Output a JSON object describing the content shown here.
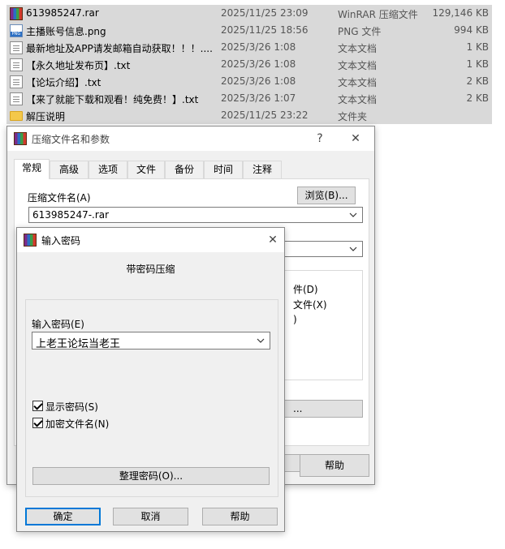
{
  "files": [
    {
      "icon": "rar-archive-icon",
      "name": "613985247.rar",
      "date": "2025/11/25 23:09",
      "type": "WinRAR 压缩文件",
      "size": "129,146 KB"
    },
    {
      "icon": "png-file-icon",
      "name": "主播账号信息.png",
      "date": "2025/11/25 18:56",
      "type": "PNG 文件",
      "size": "994 KB"
    },
    {
      "icon": "text-file-icon",
      "name": "最新地址及APP请发邮箱自动获取！！！....",
      "date": "2025/3/26 1:08",
      "type": "文本文档",
      "size": "1 KB"
    },
    {
      "icon": "text-file-icon",
      "name": "【永久地址发布页】.txt",
      "date": "2025/3/26 1:08",
      "type": "文本文档",
      "size": "1 KB"
    },
    {
      "icon": "text-file-icon",
      "name": "【论坛介绍】.txt",
      "date": "2025/3/26 1:08",
      "type": "文本文档",
      "size": "2 KB"
    },
    {
      "icon": "text-file-icon",
      "name": "【来了就能下载和观看！纯免费！】.txt",
      "date": "2025/3/26 1:07",
      "type": "文本文档",
      "size": "2 KB"
    },
    {
      "icon": "folder-icon",
      "name": "解压说明",
      "date": "2025/11/25 23:22",
      "type": "文件夹",
      "size": ""
    }
  ],
  "archive_dialog": {
    "title": "压缩文件名和参数",
    "help_glyph": "?",
    "close_glyph": "✕",
    "tabs": [
      "常规",
      "高级",
      "选项",
      "文件",
      "备份",
      "时间",
      "注释"
    ],
    "archive_name_label": "压缩文件名(A)",
    "browse_label": "浏览(B)...",
    "archive_name_value": "613985247-.rar",
    "hidden_option_1": "件(D)",
    "hidden_option_2": "文件(X)",
    "hidden_option_3": ")",
    "hidden_button_label": "...",
    "help_button": "帮助"
  },
  "password_dialog": {
    "title": "输入密码",
    "close_glyph": "✕",
    "heading": "带密码压缩",
    "password_label": "输入密码(E)",
    "password_value": "上老王论坛当老王",
    "show_password_label": "显示密码(S)",
    "show_password_checked": true,
    "encrypt_names_label": "加密文件名(N)",
    "encrypt_names_checked": true,
    "organize_button": "整理密码(O)...",
    "ok_button": "确定",
    "cancel_button": "取消",
    "help_button": "帮助"
  },
  "colors": {
    "selection": "#d9d9d9",
    "dialog_bg": "#f0f0f0",
    "focus_blue": "#0078d7"
  }
}
